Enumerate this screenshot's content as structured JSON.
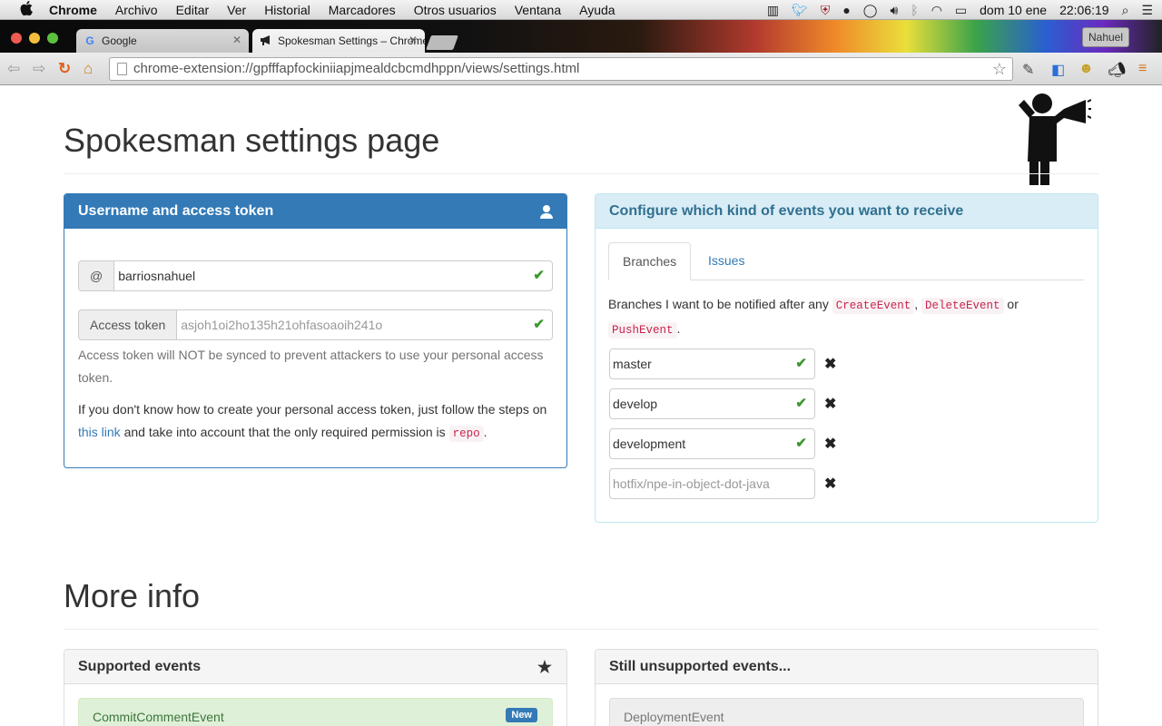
{
  "menubar": {
    "apple": "",
    "items": [
      "Chrome",
      "Archivo",
      "Editar",
      "Ver",
      "Historial",
      "Marcadores",
      "Otros usuarios",
      "Ventana",
      "Ayuda"
    ],
    "date": "dom 10 ene",
    "time": "22:06:19"
  },
  "browser": {
    "tabs": [
      {
        "title": "Google",
        "favicon": "G"
      },
      {
        "title": "Spokesman Settings – Chrome",
        "favicon": "megaphone"
      }
    ],
    "profile": "Nahuel",
    "url": "chrome-extension://gpfffapfockiniiapjmealdcbcmdhppn/views/settings.html"
  },
  "page": {
    "title": "Spokesman settings page",
    "account_panel": {
      "heading": "Username and access token",
      "username_addon": "@",
      "username_value": "barriosnahuel",
      "token_addon": "Access token",
      "token_placeholder": "asjoh1oi2ho135h21ohfasoaoih241o",
      "help_text": "Access token will NOT be synced to prevent attackers to use your personal access token.",
      "info_prefix": "If you don't know how to create your personal access token, just follow the steps on ",
      "info_link": "this link",
      "info_middle": " and take into account that the only required permission is ",
      "info_code": "repo",
      "info_suffix": "."
    },
    "events_panel": {
      "heading": "Configure which kind of events you want to receive",
      "tabs": [
        "Branches",
        "Issues"
      ],
      "desc_prefix": "Branches I want to be notified after any ",
      "code1": "CreateEvent",
      "sep1": ",",
      "code2": "DeleteEvent",
      "sep2": " or",
      "code3": "PushEvent",
      "sep3": ".",
      "branches": [
        "master",
        "develop",
        "development"
      ],
      "branch_placeholder": "hotfix/npe-in-object-dot-java"
    },
    "more_info_title": "More info",
    "supported_panel": {
      "heading": "Supported events",
      "first_item": "CommitCommentEvent",
      "first_badge": "New"
    },
    "unsupported_panel": {
      "heading": "Still unsupported events...",
      "first_item": "DeploymentEvent"
    }
  }
}
